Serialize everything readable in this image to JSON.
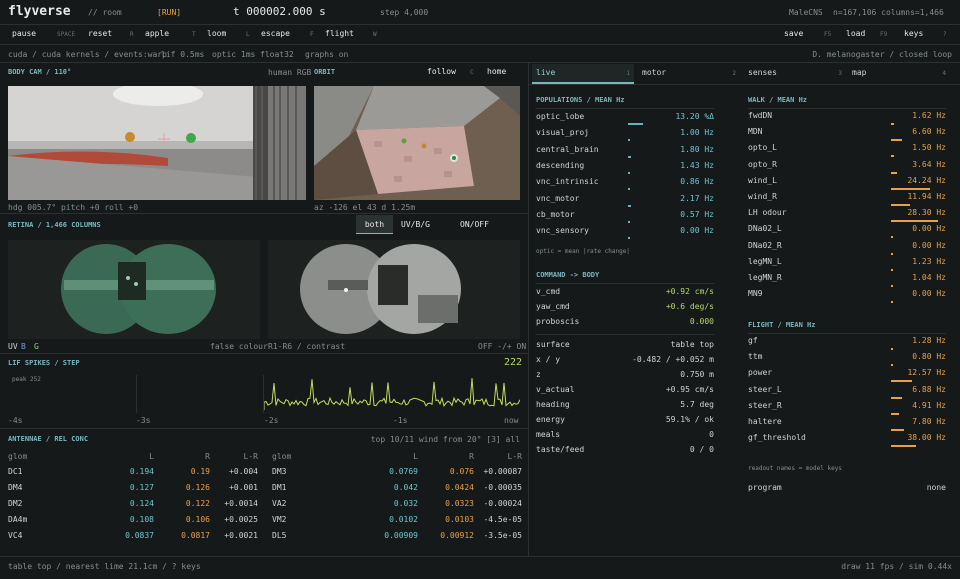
{
  "header": {
    "app": "flyverse",
    "room": "// room",
    "run": "[RUN]",
    "time": "t 000002.000 s",
    "step": "step 4,000",
    "model": "MaleCNS",
    "counts": "n=167,106 columns=1,466"
  },
  "toolbar": {
    "items": [
      {
        "label": "pause",
        "key": "SPACE"
      },
      {
        "label": "reset",
        "key": "R"
      },
      {
        "label": "apple",
        "key": "T"
      },
      {
        "label": "loom",
        "key": "L"
      },
      {
        "label": "escape",
        "key": "F"
      },
      {
        "label": "flight",
        "key": "W"
      }
    ],
    "right": [
      {
        "label": "save",
        "key": "F5"
      },
      {
        "label": "load",
        "key": "F9"
      },
      {
        "label": "keys",
        "key": "?"
      }
    ]
  },
  "info": {
    "left": [
      "cuda / cuda kernels / events:warp",
      "lif 0.5ms",
      "optic 1ms",
      "float32",
      "graphs on"
    ],
    "right": "D. melanogaster / closed loop"
  },
  "bodycam": {
    "title": "BODY CAM / 110°",
    "mode": "human RGB",
    "readout": "hdg 005.7°  pitch +0  roll +0"
  },
  "orbit": {
    "title": "ORBIT",
    "follow": "follow",
    "follow_key": "C",
    "home": "home",
    "readout": "az -126  el 43  d 1.25m"
  },
  "retina": {
    "title": "RETINA / 1,466 COLUMNS",
    "tabs": [
      "both",
      "UV/B/G",
      "ON/OFF"
    ],
    "left_legend": [
      "UV",
      "B",
      "G"
    ],
    "left_note": "false colour",
    "right_note": "R1-R6 / contrast",
    "right_legend": "OFF -/+ ON"
  },
  "lif": {
    "title": "LIF SPIKES / STEP",
    "count": "222",
    "peak": "peak 252",
    "ticks_left": [
      "-4s",
      "-3s"
    ],
    "ticks_right": [
      "-2s",
      "-1s",
      "now"
    ]
  },
  "antennae": {
    "title": "ANTENNAE / REL CONC",
    "note": "top 10/11  wind from 20°  [3] all",
    "headers": [
      "glom",
      "L",
      "R",
      "L-R"
    ],
    "left": [
      [
        "DC1",
        "0.194",
        "0.19",
        "+0.004"
      ],
      [
        "DM4",
        "0.127",
        "0.126",
        "+0.001"
      ],
      [
        "DM2",
        "0.124",
        "0.122",
        "+0.0014"
      ],
      [
        "DA4m",
        "0.108",
        "0.106",
        "+0.0025"
      ],
      [
        "VC4",
        "0.0837",
        "0.0817",
        "+0.0021"
      ]
    ],
    "right": [
      [
        "DM3",
        "0.0769",
        "0.076",
        "+0.00087"
      ],
      [
        "DM1",
        "0.042",
        "0.0424",
        "-0.00035"
      ],
      [
        "VA2",
        "0.032",
        "0.0323",
        "-0.00024"
      ],
      [
        "VM2",
        "0.0102",
        "0.0103",
        "-4.5e-05"
      ],
      [
        "DL5",
        "0.00909",
        "0.00912",
        "-3.5e-05"
      ]
    ]
  },
  "tabs": [
    {
      "label": "live",
      "n": "1"
    },
    {
      "label": "motor",
      "n": "2"
    },
    {
      "label": "senses",
      "n": "3"
    },
    {
      "label": "map",
      "n": "4"
    }
  ],
  "populations": {
    "title": "POPULATIONS / MEAN Hz",
    "rows": [
      [
        "optic_lobe",
        "13.20 %Δ",
        0.3
      ],
      [
        "visual_proj",
        "1.00 Hz",
        0.03
      ],
      [
        "central_brain",
        "1.80 Hz",
        0.05
      ],
      [
        "descending",
        "1.43 Hz",
        0.04
      ],
      [
        "vnc_intrinsic",
        "0.86 Hz",
        0.02
      ],
      [
        "vnc_motor",
        "2.17 Hz",
        0.06
      ],
      [
        "cb_motor",
        "0.57 Hz",
        0.02
      ],
      [
        "vnc_sensory",
        "0.00 Hz",
        0
      ]
    ],
    "note": "optic = mean |rate change|"
  },
  "command": {
    "title": "COMMAND -> BODY",
    "rows": [
      [
        "v_cmd",
        "+0.92 cm/s"
      ],
      [
        "yaw_cmd",
        "+0.6 deg/s"
      ],
      [
        "proboscis",
        "0.000"
      ]
    ]
  },
  "state": {
    "rows": [
      [
        "surface",
        "table top"
      ],
      [
        "x / y",
        "-0.482 / +0.052 m"
      ],
      [
        "z",
        "0.750 m"
      ],
      [
        "v_actual",
        "+0.95 cm/s"
      ],
      [
        "heading",
        "5.7 deg"
      ],
      [
        "energy",
        "59.1% / ok"
      ],
      [
        "meals",
        "0"
      ],
      [
        "taste/feed",
        "0 / 0"
      ]
    ]
  },
  "walk": {
    "title": "WALK / MEAN Hz",
    "rows": [
      [
        "fwdDN",
        "1.62 Hz",
        0.06
      ],
      [
        "MDN",
        "6.60 Hz",
        0.2
      ],
      [
        "opto_L",
        "1.50 Hz",
        0.05
      ],
      [
        "opto_R",
        "3.64 Hz",
        0.11
      ],
      [
        "wind_L",
        "24.24 Hz",
        0.7
      ],
      [
        "wind_R",
        "11.94 Hz",
        0.35
      ],
      [
        "LH odour",
        "28.30 Hz",
        0.85
      ],
      [
        "DNa02_L",
        "0.00 Hz",
        0
      ],
      [
        "DNa02_R",
        "0.00 Hz",
        0
      ],
      [
        "legMN_L",
        "1.23 Hz",
        0.04
      ],
      [
        "legMN_R",
        "1.04 Hz",
        0.03
      ],
      [
        "MN9",
        "0.00 Hz",
        0
      ]
    ]
  },
  "flight": {
    "title": "FLIGHT / MEAN Hz",
    "rows": [
      [
        "gf",
        "1.28 Hz",
        0.04
      ],
      [
        "ttm",
        "0.80 Hz",
        0.03
      ],
      [
        "power",
        "12.57 Hz",
        0.38
      ],
      [
        "steer_L",
        "6.88 Hz",
        0.2
      ],
      [
        "steer_R",
        "4.91 Hz",
        0.15
      ],
      [
        "haltere",
        "7.80 Hz",
        0.23
      ],
      [
        "gf_threshold",
        "38.00 Hz",
        0.45
      ]
    ],
    "note": "readout names = model keys",
    "program_label": "program",
    "program_value": "none"
  },
  "status": {
    "left": "table top / nearest lime 21.1cm / ? keys",
    "right": "draw 11 fps / sim 0.44x"
  }
}
